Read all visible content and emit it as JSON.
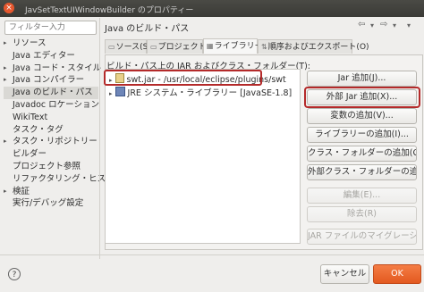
{
  "window": {
    "title": "JavSetTextUIWindowBuilder のプロパティー",
    "close_glyph": "×"
  },
  "filter": {
    "placeholder": "フィルター入力"
  },
  "nav": {
    "items": [
      {
        "label": "リソース",
        "arrow": "▸"
      },
      {
        "label": "Java エディター",
        "arrow": ""
      },
      {
        "label": "Java コード・スタイル",
        "arrow": "▸"
      },
      {
        "label": "Java コンパイラー",
        "arrow": "▸"
      },
      {
        "label": "Java のビルド・パス",
        "arrow": "",
        "selected": true
      },
      {
        "label": "Javadoc ロケーション",
        "arrow": ""
      },
      {
        "label": "WikiText",
        "arrow": ""
      },
      {
        "label": "タスク・タグ",
        "arrow": ""
      },
      {
        "label": "タスク・リポジトリー",
        "arrow": "▸"
      },
      {
        "label": "ビルダー",
        "arrow": ""
      },
      {
        "label": "プロジェクト参照",
        "arrow": ""
      },
      {
        "label": "リファクタリング・ヒストリー",
        "arrow": ""
      },
      {
        "label": "検証",
        "arrow": "▸"
      },
      {
        "label": "実行/デバッグ設定",
        "arrow": ""
      }
    ]
  },
  "page": {
    "title": "Java のビルド・パス"
  },
  "history": {
    "back": "⇦",
    "forward": "⇨",
    "menu": "▾"
  },
  "tabs": [
    {
      "label": "ソース(S)",
      "icon": "▭"
    },
    {
      "label": "プロジェクト(P)",
      "icon": "▭"
    },
    {
      "label": "ライブラリー(L)",
      "icon": "▦",
      "active": true
    },
    {
      "label": "順序およびエクスポート(O)",
      "icon": "⇅"
    }
  ],
  "libraries": {
    "label": "ビルド・パス上の JAR およびクラス・フォルダー(T):",
    "entries": [
      {
        "text": "swt.jar - /usr/local/eclipse/plugins/swt",
        "expander": "▸"
      },
      {
        "text": "JRE システム・ライブラリー [JavaSE-1.8]",
        "expander": "▸"
      }
    ]
  },
  "buttons": [
    {
      "label": "Jar 追加(J)...",
      "enabled": true
    },
    {
      "label": "外部 Jar 追加(X)...",
      "enabled": true
    },
    {
      "label": "変数の追加(V)...",
      "enabled": true
    },
    {
      "label": "ライブラリーの追加(I)...",
      "enabled": true
    },
    {
      "label": "クラス・フォルダーの追加(C)...",
      "enabled": true
    },
    {
      "label": "外部クラス・フォルダーの追加(D)...",
      "enabled": true
    },
    {
      "label": "編集(E)...",
      "enabled": false
    },
    {
      "label": "除去(R)",
      "enabled": false
    },
    {
      "label": "JAR ファイルのマイグレーション(M)...",
      "enabled": false
    }
  ],
  "footer": {
    "help": "?",
    "cancel": "キャンセル",
    "ok": "OK"
  },
  "colors": {
    "highlight": "#b42a2a",
    "ok": "#e3591f"
  }
}
